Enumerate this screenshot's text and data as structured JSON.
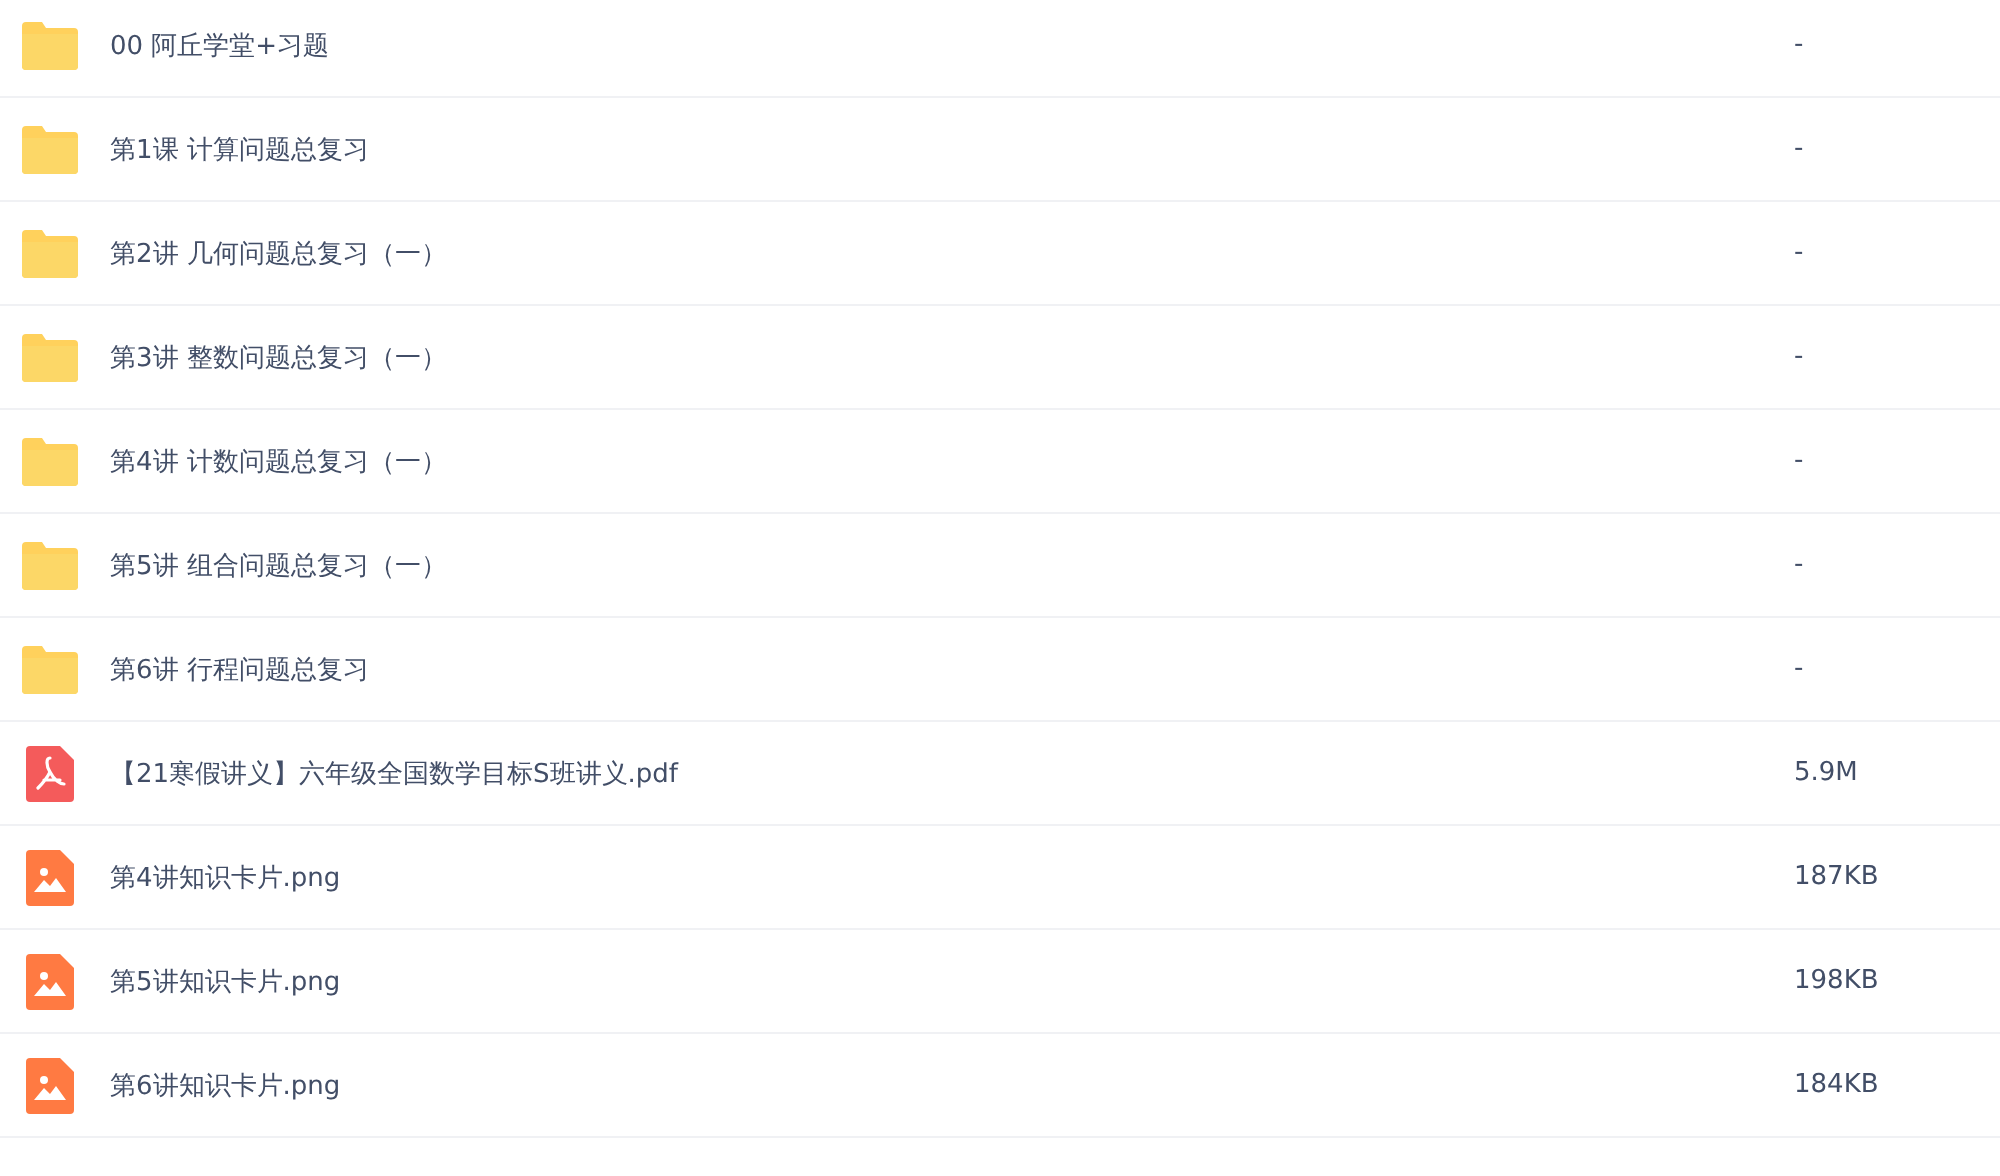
{
  "files": [
    {
      "kind": "folder",
      "name": "00 阿丘学堂+习题",
      "size": "-"
    },
    {
      "kind": "folder",
      "name": "第1课 计算问题总复习",
      "size": "-"
    },
    {
      "kind": "folder",
      "name": "第2讲 几何问题总复习（一）",
      "size": "-"
    },
    {
      "kind": "folder",
      "name": "第3讲 整数问题总复习（一）",
      "size": "-"
    },
    {
      "kind": "folder",
      "name": "第4讲 计数问题总复习（一）",
      "size": "-"
    },
    {
      "kind": "folder",
      "name": "第5讲 组合问题总复习（一）",
      "size": "-"
    },
    {
      "kind": "folder",
      "name": "第6讲 行程问题总复习",
      "size": "-"
    },
    {
      "kind": "pdf",
      "name": "【21寒假讲义】六年级全国数学目标S班讲义.pdf",
      "size": "5.9M"
    },
    {
      "kind": "image",
      "name": "第4讲知识卡片.png",
      "size": "187KB"
    },
    {
      "kind": "image",
      "name": "第5讲知识卡片.png",
      "size": "198KB"
    },
    {
      "kind": "image",
      "name": "第6讲知识卡片.png",
      "size": "184KB"
    }
  ]
}
